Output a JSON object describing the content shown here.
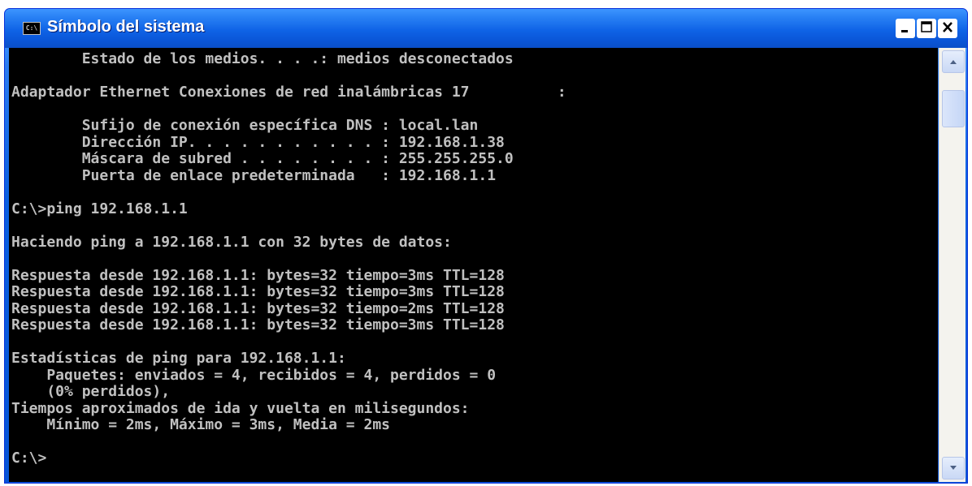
{
  "window": {
    "title": "Símbolo del sistema",
    "icon_text": "C:\\",
    "icon": "console-icon",
    "controls": {
      "minimize": "minimize-icon",
      "maximize": "maximize-icon",
      "close": "close-icon"
    }
  },
  "console": {
    "lines": [
      "        Estado de los medios. . . .: medios desconectados",
      "",
      "Adaptador Ethernet Conexiones de red inalámbricas 17          :",
      "",
      "        Sufijo de conexión específica DNS : local.lan",
      "        Dirección IP. . . . . . . . . . . : 192.168.1.38",
      "        Máscara de subred . . . . . . . . : 255.255.255.0",
      "        Puerta de enlace predeterminada   : 192.168.1.1",
      "",
      "C:\\>ping 192.168.1.1",
      "",
      "Haciendo ping a 192.168.1.1 con 32 bytes de datos:",
      "",
      "Respuesta desde 192.168.1.1: bytes=32 tiempo=3ms TTL=128",
      "Respuesta desde 192.168.1.1: bytes=32 tiempo=3ms TTL=128",
      "Respuesta desde 192.168.1.1: bytes=32 tiempo=2ms TTL=128",
      "Respuesta desde 192.168.1.1: bytes=32 tiempo=3ms TTL=128",
      "",
      "Estadísticas de ping para 192.168.1.1:",
      "    Paquetes: enviados = 4, recibidos = 4, perdidos = 0",
      "    (0% perdidos),",
      "Tiempos aproximados de ida y vuelta en milisegundos:",
      "    Mínimo = 2ms, Máximo = 3ms, Media = 2ms",
      "",
      "C:\\>"
    ]
  },
  "scrollbar": {
    "up": "arrow-up-icon",
    "down": "arrow-down-icon"
  },
  "colors": {
    "console_bg": "#000000",
    "console_fg": "#c0c0c0",
    "titlebar": "#0a56d8"
  }
}
